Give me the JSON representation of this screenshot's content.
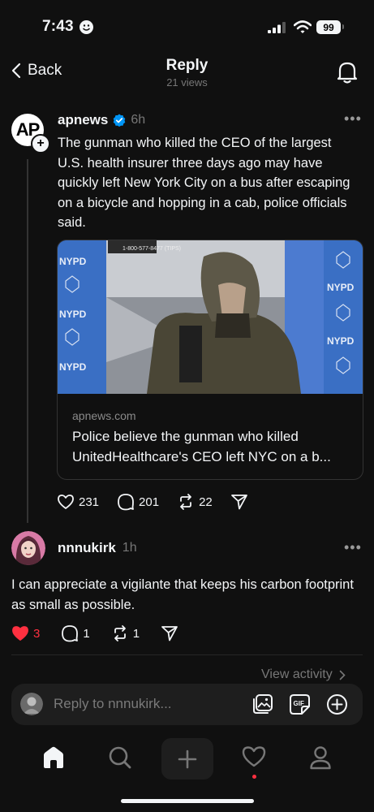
{
  "status_bar": {
    "time": "7:43",
    "battery": "99"
  },
  "header": {
    "back_label": "Back",
    "title": "Reply",
    "views": "21 views"
  },
  "post": {
    "username": "apnews",
    "time": "6h",
    "avatar_text": "AP",
    "text": "The gunman who killed the CEO of the largest U.S. health insurer three days ago may have quickly left New York City on a bus after escaping on a bicycle and hopping in a cab, police officials said.",
    "link_card": {
      "domain": "apnews.com",
      "title": "Police believe the gunman who killed UnitedHealthcare's CEO left NYC on a b...",
      "image_text": {
        "brand": "NYPD",
        "hotline": "1-800-577-8477 (TIPS)"
      }
    },
    "likes": "231",
    "replies": "201",
    "reposts": "22"
  },
  "reply": {
    "username": "nnnukirk",
    "time": "1h",
    "text": "I can appreciate a vigilante that keeps his carbon footprint as small as possible.",
    "likes": "3",
    "replies": "1",
    "reposts": "1",
    "view_activity": "View activity"
  },
  "composer": {
    "placeholder": "Reply to nnnukirk..."
  },
  "colors": {
    "background": "#101010",
    "like_red": "#ff3040",
    "verified_blue": "#0095f6"
  }
}
